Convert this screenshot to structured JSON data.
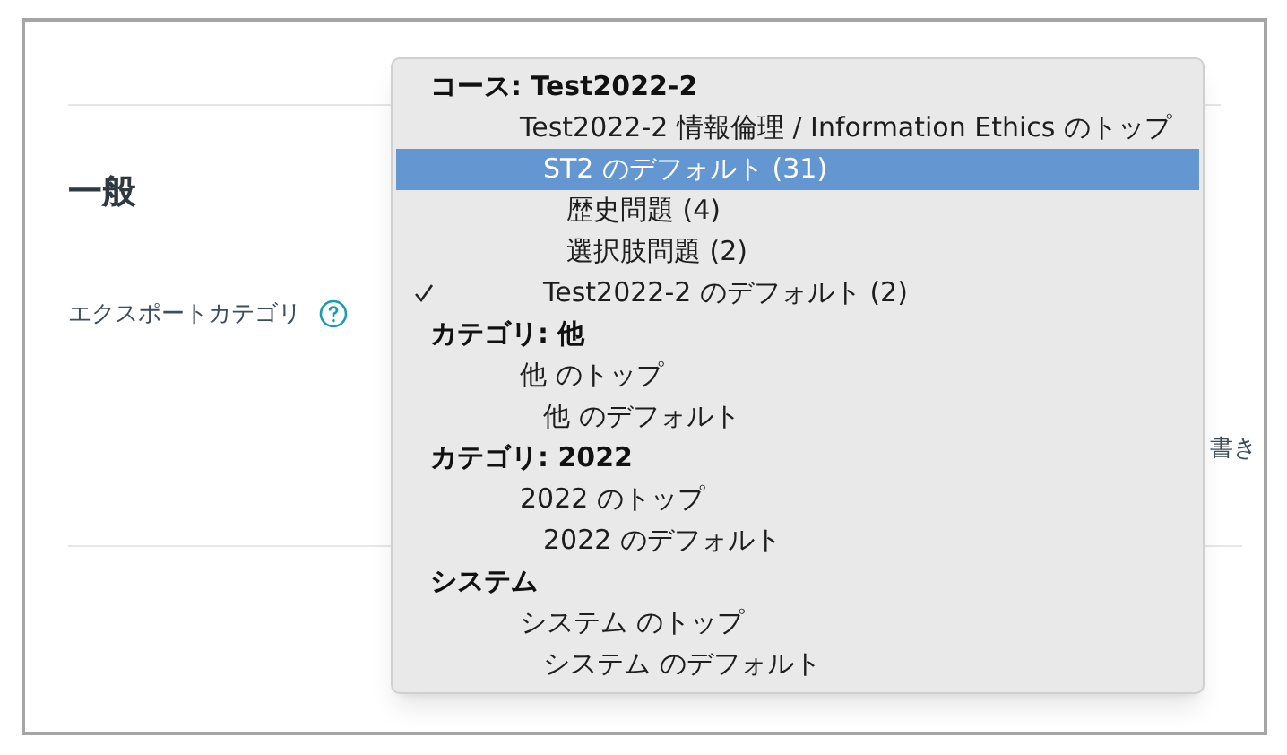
{
  "section": {
    "heading": "一般",
    "field_label": "エクスポートカテゴリ",
    "cut_text": "書き"
  },
  "dropdown": {
    "groups": [
      {
        "label": "コース: Test2022-2",
        "options": [
          {
            "label": "Test2022-2 情報倫理 / Information Ethics のトップ",
            "selected": false,
            "checked": false,
            "children": [
              {
                "label": "ST2 のデフォルト (31)",
                "selected": true,
                "checked": false,
                "children": [
                  {
                    "label": "歴史問題 (4)",
                    "selected": false,
                    "checked": false
                  },
                  {
                    "label": "選択肢問題 (2)",
                    "selected": false,
                    "checked": false
                  }
                ]
              },
              {
                "label": "Test2022-2 のデフォルト (2)",
                "selected": false,
                "checked": true
              }
            ]
          }
        ]
      },
      {
        "label": "カテゴリ: 他",
        "options": [
          {
            "label": "他 のトップ",
            "selected": false,
            "checked": false,
            "children": [
              {
                "label": "他 のデフォルト",
                "selected": false,
                "checked": false
              }
            ]
          }
        ]
      },
      {
        "label": "カテゴリ: 2022",
        "options": [
          {
            "label": "2022 のトップ",
            "selected": false,
            "checked": false,
            "children": [
              {
                "label": "2022 のデフォルト",
                "selected": false,
                "checked": false
              }
            ]
          }
        ]
      },
      {
        "label": "システム",
        "options": [
          {
            "label": "システム のトップ",
            "selected": false,
            "checked": false,
            "children": [
              {
                "label": "システム のデフォルト",
                "selected": false,
                "checked": false
              }
            ]
          }
        ]
      }
    ]
  }
}
